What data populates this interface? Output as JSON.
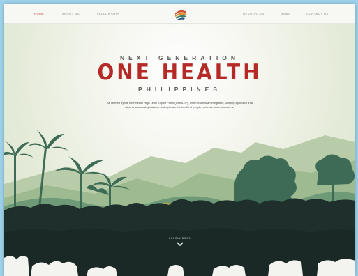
{
  "nav": {
    "left": [
      "HOME",
      "ABOUT US",
      "FELLOWSHIP"
    ],
    "right": [
      "RESOURCES",
      "NEWS",
      "CONTACT US"
    ],
    "active": "HOME"
  },
  "hero": {
    "kicker": "NEXT GENERATION",
    "title": "ONE HEALTH",
    "subtitle": "PHILIPPINES",
    "description": "As defined by the One Health High Level Expert Panel (OHHLEP), One Health is an integrated, unifying approach that aims to sustainably balance and optimize the health of people, animals and ecosystems.",
    "scroll_label": "SCROLL DOWN"
  },
  "colors": {
    "accent": "#b52a26",
    "background": "#f3f3ef",
    "forest_dark": "#1e2f2c",
    "forest_mid": "#3e6b55",
    "forest_light": "#6f9a78",
    "page_backdrop": "#9fd3ec"
  },
  "icons": {
    "logo": "globe-swirl-logo",
    "scroll": "chevron-down-icon"
  }
}
